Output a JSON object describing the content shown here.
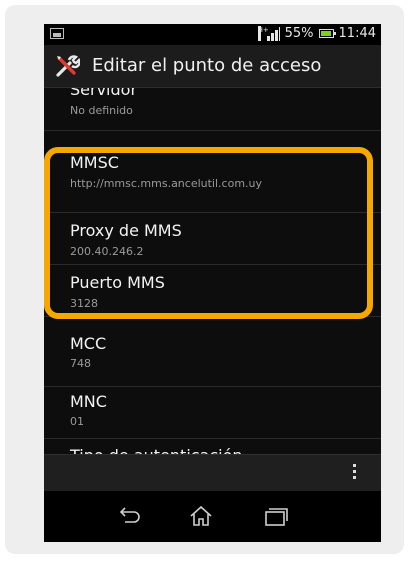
{
  "status": {
    "battery_percent": "55%",
    "time": "11:44",
    "network_tag": "H+",
    "battery_color": "#7bd321"
  },
  "actionbar": {
    "title": "Editar el punto de acceso",
    "icon": "tools-icon"
  },
  "settings": [
    {
      "label": "Servidor",
      "value": "No definido"
    },
    {
      "label": "MMSC",
      "value": "http://mmsc.mms.ancelutil.com.uy"
    },
    {
      "label": "Proxy de MMS",
      "value": "200.40.246.2"
    },
    {
      "label": "Puerto MMS",
      "value": "3128"
    },
    {
      "label": "MCC",
      "value": "748"
    },
    {
      "label": "MNC",
      "value": "01"
    },
    {
      "label": "Tipo de autenticación",
      "value": ""
    }
  ],
  "colors": {
    "highlight": "#f5a800",
    "background": "#0d0d0d"
  },
  "navigation": {
    "icons": [
      "back-icon",
      "home-icon",
      "recent-apps-icon"
    ]
  }
}
